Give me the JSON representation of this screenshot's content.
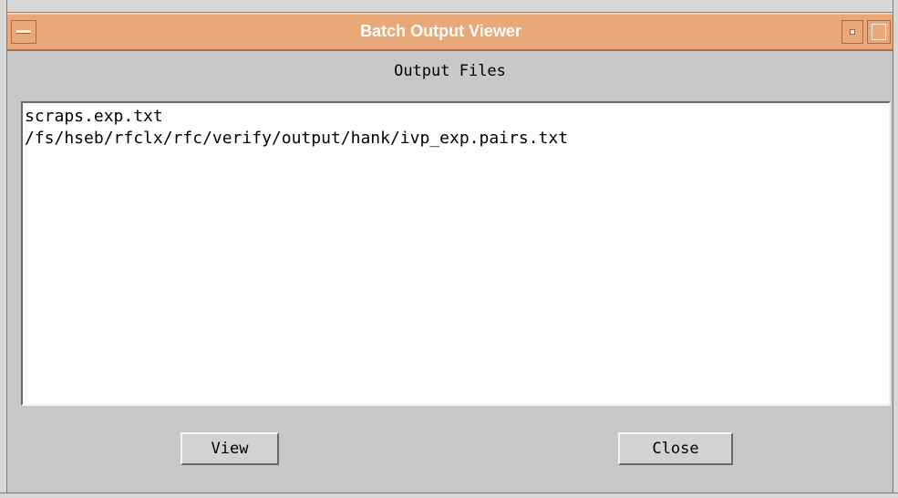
{
  "window": {
    "title": "Batch Output Viewer"
  },
  "main": {
    "heading": "Output Files",
    "files": [
      "scraps.exp.txt",
      "/fs/hseb/rfclx/rfc/verify/output/hank/ivp_exp.pairs.txt"
    ]
  },
  "buttons": {
    "view_label": "View",
    "close_label": "Close"
  },
  "colors": {
    "titlebar": "#e8a878",
    "background": "#c8c8c8"
  }
}
